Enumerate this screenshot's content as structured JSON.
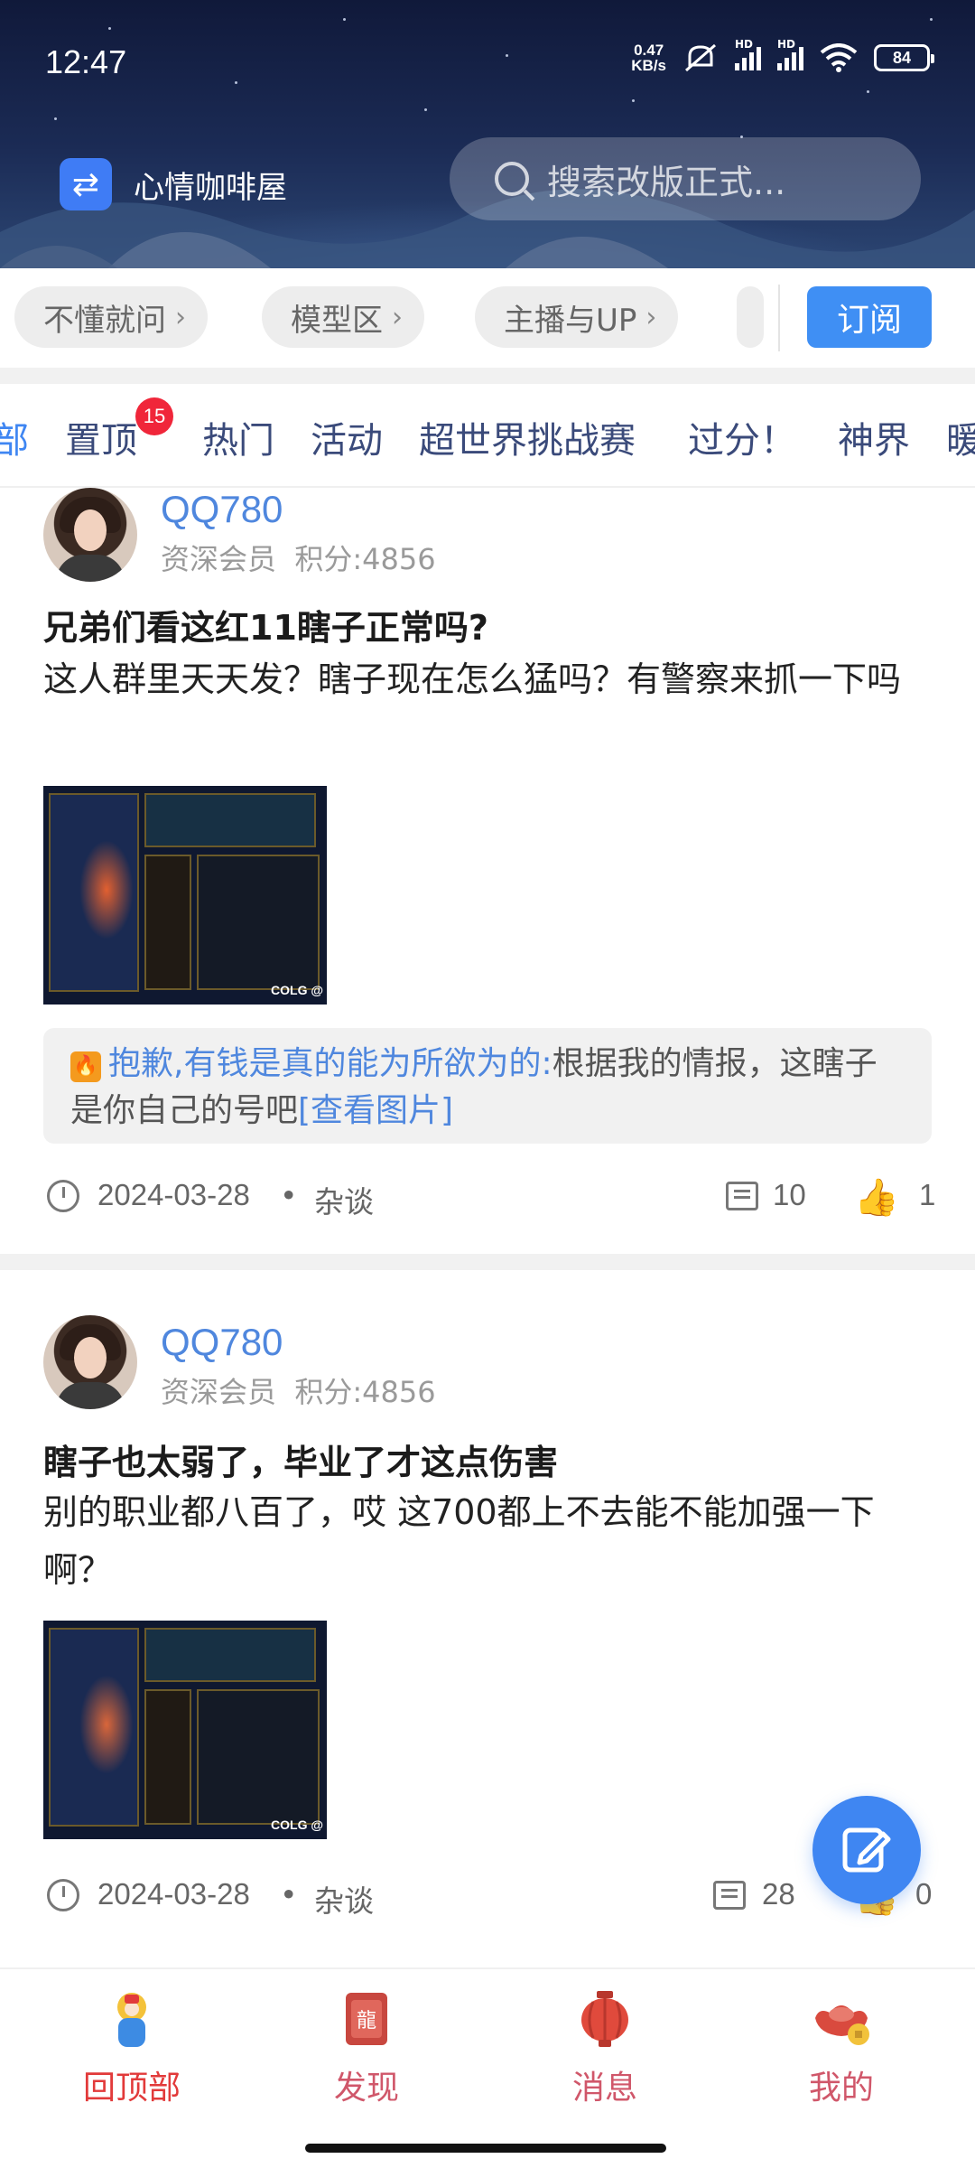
{
  "status_bar": {
    "time": "12:47",
    "net_speed_value": "0.47",
    "net_speed_unit": "KB/s",
    "signal_label": "HD",
    "battery": "84"
  },
  "header": {
    "forum_name": "心情咖啡屋",
    "search_placeholder": "搜索改版正式..."
  },
  "chips": [
    {
      "label": "不懂就问"
    },
    {
      "label": "模型区"
    },
    {
      "label": "主播与UP"
    }
  ],
  "subscribe_label": "订阅",
  "tabs": [
    "部",
    "置顶",
    "热门",
    "活动",
    "超世界挑战赛",
    "过分！",
    "神界",
    "暖"
  ],
  "pinned_badge": "15",
  "posts": [
    {
      "username": "QQ780",
      "rank": "资深会员",
      "points": "积分:4856",
      "title": "兄弟们看这红11瞎子正常吗?",
      "body": "这人群里天天发？瞎子现在怎么猛吗？有警察来抓一下吗",
      "reply_user": "抱歉,有钱是真的能为所欲为的:",
      "reply_text": "根据我的情报，这瞎子是你自己的号吧",
      "reply_link": "[查看图片]",
      "date": "2024-03-28",
      "category": "杂谈",
      "comments": "10",
      "likes": "1"
    },
    {
      "username": "QQ780",
      "rank": "资深会员",
      "points": "积分:4856",
      "title": "瞎子也太弱了，毕业了才这点伤害",
      "body": "别的职业都八百了，哎 这700都上不去能不能加强一下啊？",
      "date": "2024-03-28",
      "category": "杂谈",
      "comments": "28",
      "likes": "0"
    }
  ],
  "footer_dot": "•",
  "image_watermark": "COLG @",
  "bottom_nav": [
    {
      "label": "回顶部",
      "icon": "back-to-top-mascot-icon"
    },
    {
      "label": "发现",
      "icon": "discover-dragon-icon"
    },
    {
      "label": "消息",
      "icon": "lantern-icon"
    },
    {
      "label": "我的",
      "icon": "gold-ingot-icon"
    }
  ],
  "colors": {
    "accent": "#3f86f2",
    "username": "#4f87de",
    "badge": "#f0263a",
    "nav_active": "#e23a3a"
  }
}
